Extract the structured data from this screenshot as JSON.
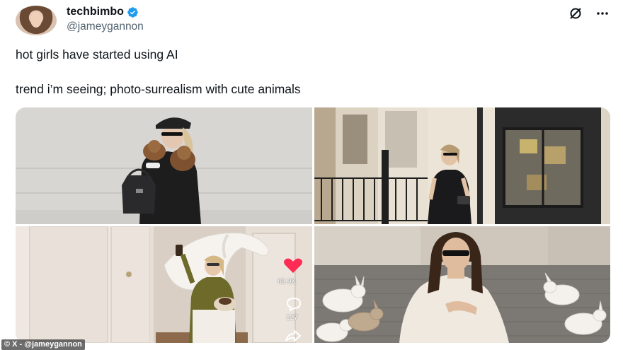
{
  "author": {
    "display_name": "techbimbo",
    "handle": "@jameygannon",
    "verified": true
  },
  "actions": {
    "grok_icon": "grok-icon",
    "more_icon": "more-horizontal-icon"
  },
  "tweet": {
    "line1": "hot girls have started using AI",
    "line2": "trend i’m seeing; photo-surrealism with cute animals"
  },
  "media": {
    "tile3_overlay": {
      "likes": "62.9K",
      "comments": "127"
    }
  },
  "watermark": "© X - @jameygannon",
  "colors": {
    "verified_blue": "#1d9bf0",
    "handle_gray": "#536471",
    "heart_red": "#fe2c55"
  }
}
